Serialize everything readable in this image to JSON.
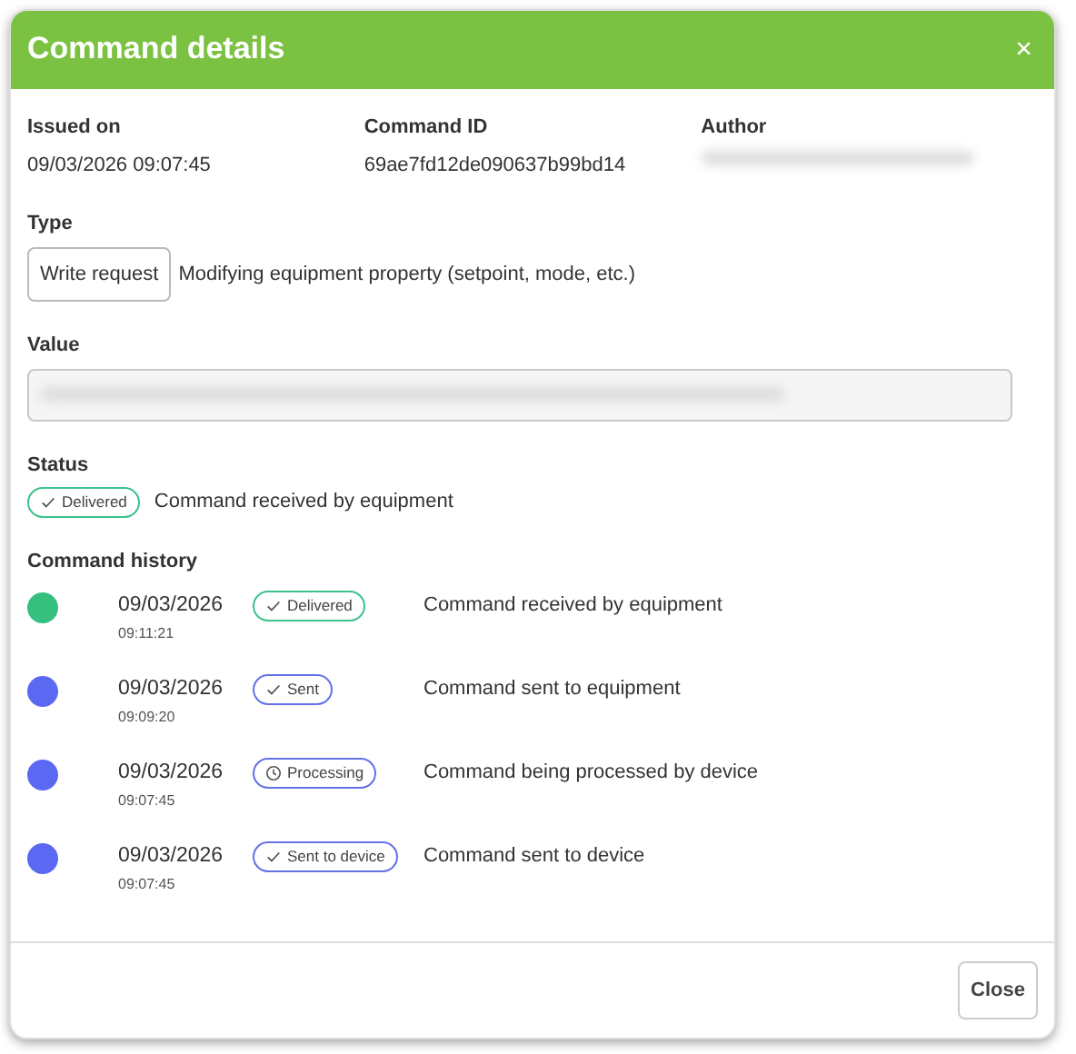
{
  "modal": {
    "title": "Command details",
    "close_icon": "×"
  },
  "info": [
    {
      "label": "Issued on",
      "value": "09/03/2026 09:07:45"
    },
    {
      "label": "Command ID",
      "value": "69ae7fd12de090637b99bd14"
    },
    {
      "label": "Author",
      "redacted": true
    }
  ],
  "type": {
    "label": "Type",
    "badge": "Write request",
    "description": "Modifying equipment property (setpoint, mode, etc.)"
  },
  "value": {
    "label": "Value",
    "redacted": true
  },
  "status": {
    "label": "Status",
    "badge": {
      "text": "Delivered",
      "kind": "done",
      "color": "#3cc28a"
    },
    "description": "Command received by equipment"
  },
  "history": {
    "title": "Command history",
    "items": [
      {
        "color": "#35c07f",
        "date": "09/03/2026",
        "time": "09:11:21",
        "badge": {
          "text": "Delivered",
          "kind": "done",
          "color": "#3cc28a"
        },
        "description": "Command received by equipment"
      },
      {
        "color": "#5b68f2",
        "date": "09/03/2026",
        "time": "09:09:20",
        "badge": {
          "text": "Sent",
          "kind": "done",
          "color": "#6470e8"
        },
        "description": "Command sent to equipment"
      },
      {
        "color": "#5b68f2",
        "date": "09/03/2026",
        "time": "09:07:45",
        "badge": {
          "text": "Processing",
          "kind": "pending",
          "color": "#6470e8"
        },
        "description": "Command being processed by device"
      },
      {
        "color": "#5b68f2",
        "date": "09/03/2026",
        "time": "09:07:45",
        "badge": {
          "text": "Sent to device",
          "kind": "done",
          "color": "#6470e8"
        },
        "description": "Command sent to device"
      }
    ]
  },
  "footer": {
    "close_button": "Close"
  }
}
